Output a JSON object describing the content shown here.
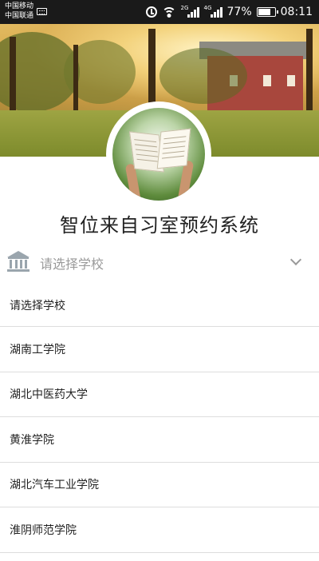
{
  "status_bar": {
    "carrier_1": "中国移动",
    "carrier_2": "中国联通",
    "network_1": "2G",
    "network_2": "4G",
    "battery": "77%",
    "time": "08:11",
    "icons": [
      "sim-icon",
      "alarm-icon",
      "wifi-icon",
      "signal-icon",
      "battery-icon"
    ]
  },
  "header": {
    "title": "智位来自习室预约系统"
  },
  "school_select": {
    "placeholder": "请选择学校",
    "icon": "school-building-icon",
    "dropdown_icon": "chevron-down-icon"
  },
  "school_options": [
    "请选择学校",
    "湖南工学院",
    "湖北中医药大学",
    "黄淮学院",
    "湖北汽车工业学院",
    "淮阴师范学院"
  ],
  "colors": {
    "title_text": "#222222",
    "placeholder_text": "#9a9a9a",
    "divider": "#dddddd",
    "icon_gray": "#9aa5ad"
  }
}
